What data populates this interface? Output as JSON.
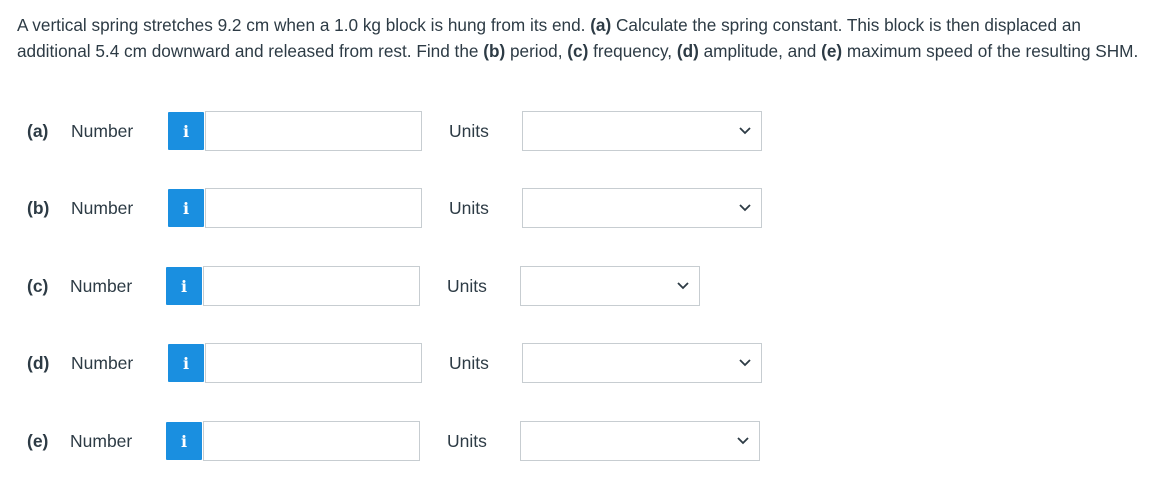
{
  "question": {
    "text_1": "A vertical spring stretches 9.2 cm when a 1.0 kg block is hung from its end. ",
    "a_tag": "(a)",
    "text_2": " Calculate the spring constant. This block is then displaced an additional 5.4 cm downward and released from rest. Find the ",
    "b_tag": "(b)",
    "text_3": " period, ",
    "c_tag": "(c)",
    "text_4": " frequency, ",
    "d_tag": "(d)",
    "text_5": " amplitude, and ",
    "e_tag": "(e)",
    "text_6": " maximum speed of the resulting SHM."
  },
  "parts": [
    {
      "part": "(a)",
      "number_label": "Number",
      "number_value": "",
      "info_icon": "i",
      "units_label": "Units",
      "units_value": ""
    },
    {
      "part": "(b)",
      "number_label": "Number",
      "number_value": "",
      "info_icon": "i",
      "units_label": "Units",
      "units_value": ""
    },
    {
      "part": "(c)",
      "number_label": "Number",
      "number_value": "",
      "info_icon": "i",
      "units_label": "Units",
      "units_value": ""
    },
    {
      "part": "(d)",
      "number_label": "Number",
      "number_value": "",
      "info_icon": "i",
      "units_label": "Units",
      "units_value": ""
    },
    {
      "part": "(e)",
      "number_label": "Number",
      "number_value": "",
      "info_icon": "i",
      "units_label": "Units",
      "units_value": ""
    }
  ],
  "colors": {
    "info_button": "#1a8fe0",
    "text": "#2d3b45",
    "input_border": "#c7cdd1"
  },
  "icons": {
    "info": "info-icon",
    "dropdown": "chevron-down-icon"
  }
}
